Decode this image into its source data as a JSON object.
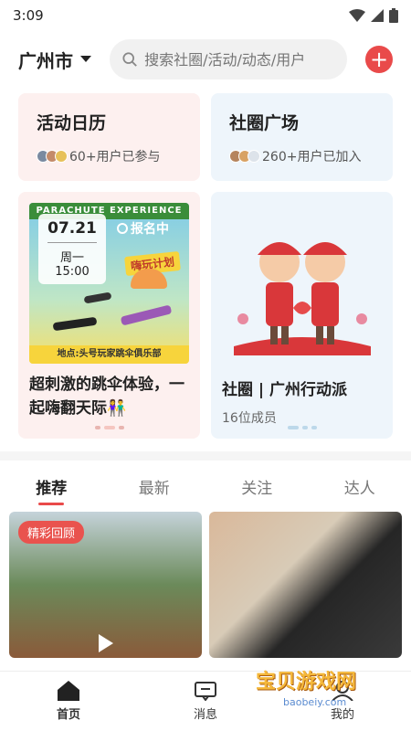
{
  "status": {
    "time": "3:09"
  },
  "header": {
    "city": "广州市",
    "search_placeholder": "搜索社圈/活动/动态/用户",
    "add_label": "+"
  },
  "top_cards": [
    {
      "title": "活动日历",
      "meta": "60+用户已参与"
    },
    {
      "title": "社圈广场",
      "meta": "260+用户已加入"
    }
  ],
  "activity_card": {
    "date": "07.21",
    "weekday": "周一",
    "time": "15:00",
    "status": "报名中",
    "poster_banner": "PARACHUTE EXPERIENCE",
    "poster_sub": "嗨玩计划",
    "poster_foot": "地点:头号玩家跳伞俱乐部",
    "title": "超刺激的跳伞体验，一起嗨翻天际👫"
  },
  "circle_card": {
    "title": "社圈 | 广州行动派",
    "members": "16位成员"
  },
  "tabs": [
    "推荐",
    "最新",
    "关注",
    "达人"
  ],
  "feed": {
    "badge": "精彩回顾"
  },
  "bottom_nav": [
    {
      "label": "首页",
      "icon": "home-icon"
    },
    {
      "label": "消息",
      "icon": "message-icon"
    },
    {
      "label": "我的",
      "icon": "profile-icon"
    }
  ],
  "watermark": {
    "text": "宝贝游戏网",
    "url": "baobeiy.com"
  },
  "colors": {
    "accent": "#e94a4a",
    "pink_card": "#fdf0ef",
    "blue_card": "#eef5fb"
  }
}
